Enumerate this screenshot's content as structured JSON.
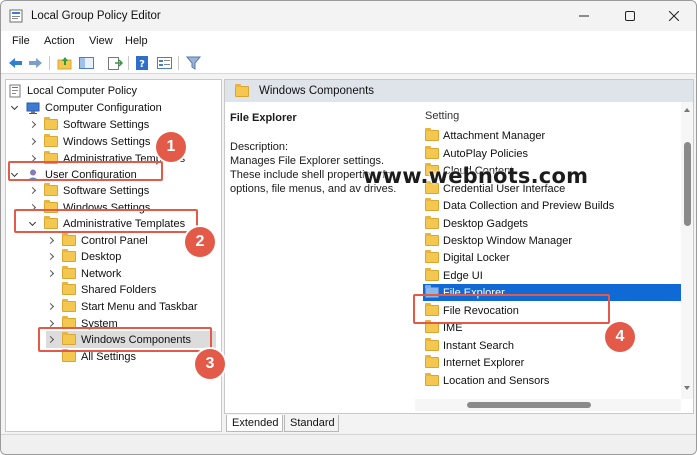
{
  "window": {
    "title": "Local Group Policy Editor",
    "controls": {
      "minimize": "—",
      "maximize": "☐",
      "close": "✕"
    }
  },
  "menu": [
    "File",
    "Action",
    "View",
    "Help"
  ],
  "toolbar": {
    "icons": [
      "back-arrow-icon",
      "forward-arrow-icon",
      "folder-up-icon",
      "show-hide-tree-icon",
      "export-list-icon",
      "help-icon",
      "properties-icon",
      "filter-icon"
    ]
  },
  "tree": {
    "items": [
      {
        "label": "Local Computer Policy",
        "level": 0,
        "chevron": "none",
        "icon": "computer-policy-icon"
      },
      {
        "label": "Computer Configuration",
        "level": 1,
        "chevron": "down",
        "icon": "computer-icon"
      },
      {
        "label": "Software Settings",
        "level": 2,
        "chevron": "right",
        "icon": "folder-icon"
      },
      {
        "label": "Windows Settings",
        "level": 2,
        "chevron": "right",
        "icon": "folder-icon"
      },
      {
        "label": "Administrative Templates",
        "level": 2,
        "chevron": "right",
        "icon": "folder-icon"
      },
      {
        "label": "User Configuration",
        "level": 1,
        "chevron": "down",
        "icon": "user-icon"
      },
      {
        "label": "Software Settings",
        "level": 2,
        "chevron": "right",
        "icon": "folder-icon"
      },
      {
        "label": "Windows Settings",
        "level": 2,
        "chevron": "right",
        "icon": "folder-icon"
      },
      {
        "label": "Administrative Templates",
        "level": 2,
        "chevron": "down",
        "icon": "folder-icon"
      },
      {
        "label": "Control Panel",
        "level": 3,
        "chevron": "right",
        "icon": "folder-icon"
      },
      {
        "label": "Desktop",
        "level": 3,
        "chevron": "right",
        "icon": "folder-icon"
      },
      {
        "label": "Network",
        "level": 3,
        "chevron": "right",
        "icon": "folder-icon"
      },
      {
        "label": "Shared Folders",
        "level": 3,
        "chevron": "none",
        "icon": "folder-icon"
      },
      {
        "label": "Start Menu and Taskbar",
        "level": 3,
        "chevron": "right",
        "icon": "folder-icon"
      },
      {
        "label": "System",
        "level": 3,
        "chevron": "right",
        "icon": "folder-icon"
      },
      {
        "label": "Windows Components",
        "level": 3,
        "chevron": "right",
        "icon": "folder-icon",
        "highlighted": true
      },
      {
        "label": "All Settings",
        "level": 3,
        "chevron": "none",
        "icon": "folder-icon"
      }
    ]
  },
  "content": {
    "header": "Windows Components",
    "description": {
      "title": "File Explorer",
      "label": "Description:",
      "text": "Manages File Explorer settings. These include shell properties, fo options, file menus, and av drives."
    },
    "list_header": "Setting",
    "items": [
      "Attachment Manager",
      "AutoPlay Policies",
      "Cloud Content",
      "Credential User Interface",
      "Data Collection and Preview Builds",
      "Desktop Gadgets",
      "Desktop Window Manager",
      "Digital Locker",
      "Edge UI",
      "File Explorer",
      "File Revocation",
      "IME",
      "Instant Search",
      "Internet Explorer",
      "Location and Sensors"
    ],
    "selected_item": "File Explorer"
  },
  "tabs": [
    "Extended",
    "Standard"
  ],
  "active_tab": "Extended",
  "watermark": "www.webnots.com",
  "callouts": [
    "1",
    "2",
    "3",
    "4"
  ],
  "colors": {
    "callout": "#e35a48",
    "selection": "#0f6ad6",
    "header_bg": "#dfe3ea",
    "folder": "#f3c750"
  }
}
